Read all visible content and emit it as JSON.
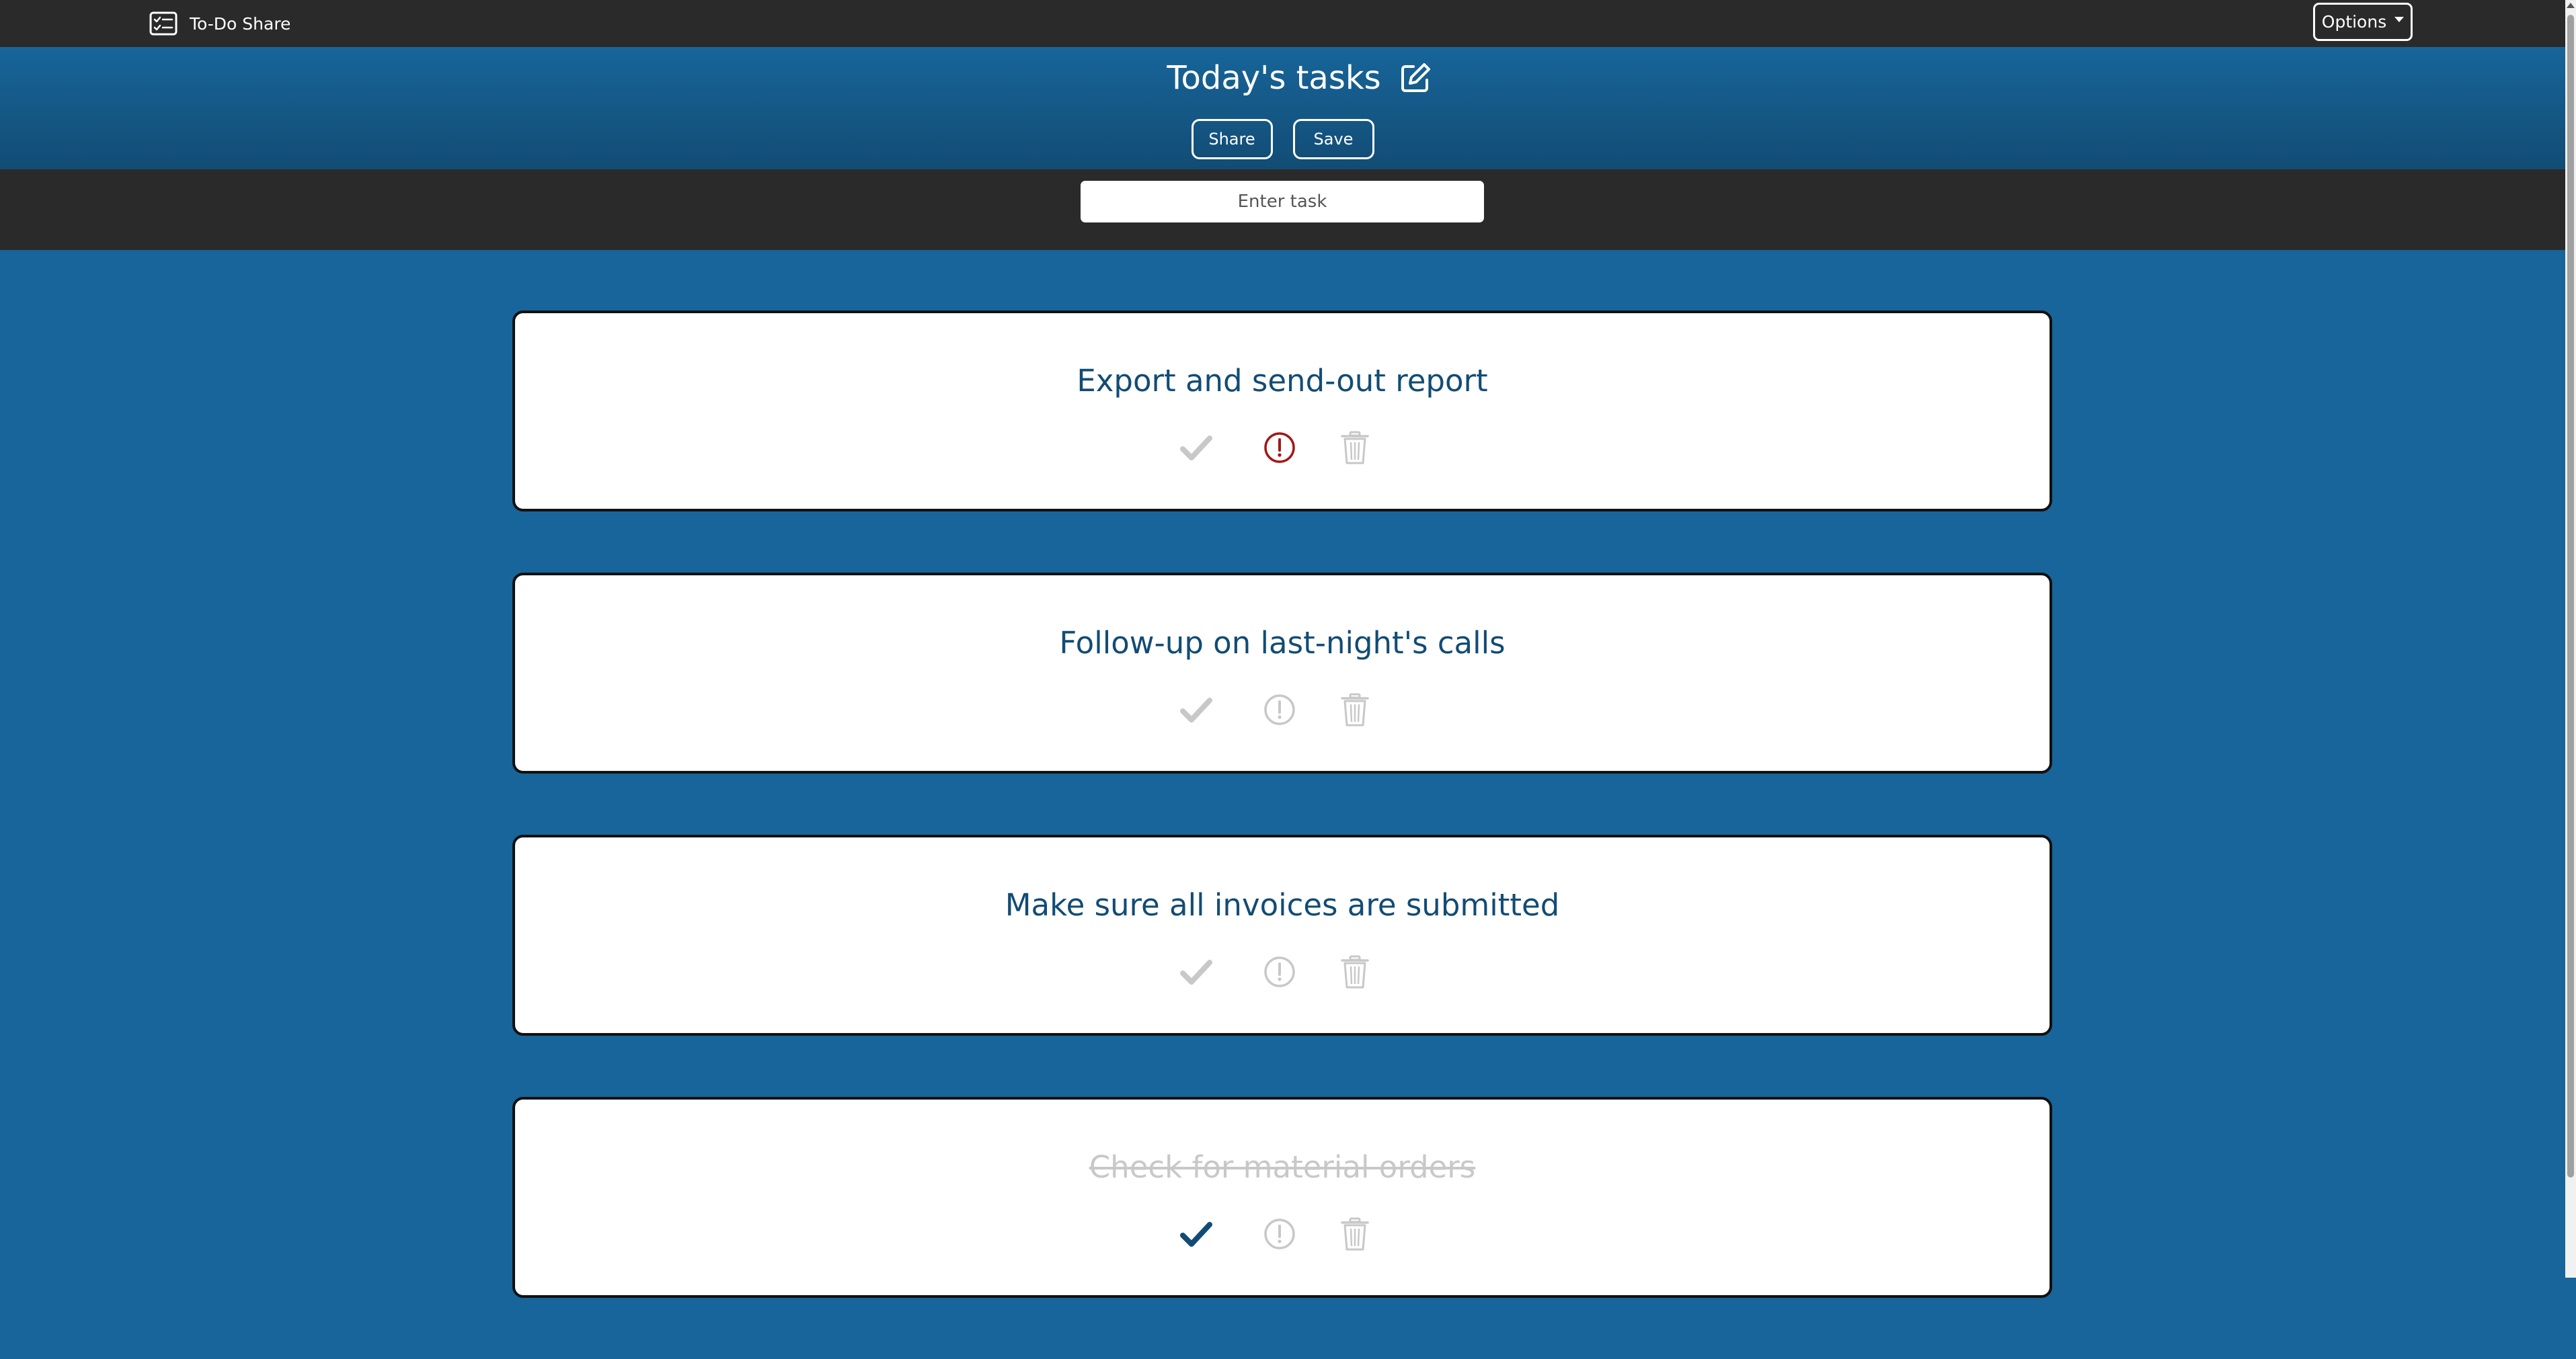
{
  "navbar": {
    "brand": "To-Do Share",
    "brand_icon": "checklist-icon",
    "options_label": "Options"
  },
  "header": {
    "list_title": "Today's tasks",
    "edit_icon": "edit-icon",
    "share_label": "Share",
    "save_label": "Save"
  },
  "input": {
    "placeholder": "Enter task"
  },
  "tasks": [
    {
      "text": "Export and send-out report",
      "done": false,
      "important": true
    },
    {
      "text": "Follow-up on last-night's calls",
      "done": false,
      "important": false
    },
    {
      "text": "Make sure all invoices are submitted",
      "done": false,
      "important": false
    },
    {
      "text": "Check for material orders",
      "done": true,
      "important": false
    }
  ],
  "colors": {
    "page_bg": "#17659a",
    "header_dark": "#124c74",
    "bar_bg": "#2a2a2a",
    "task_text": "#124c74",
    "icon_inactive": "#c8c8c8",
    "icon_important": "#a01818",
    "icon_done": "#124c74"
  }
}
